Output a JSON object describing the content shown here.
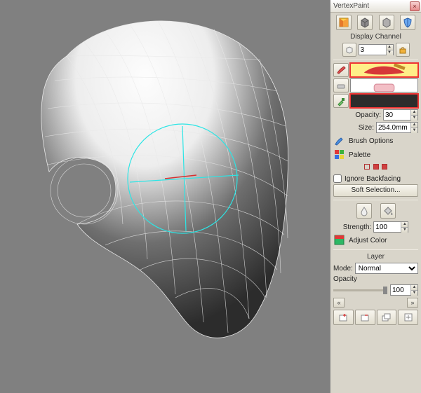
{
  "panel": {
    "title": "VertexPaint",
    "close": "×",
    "display_channel_label": "Display Channel",
    "channel_value": "3",
    "opacity_label": "Opacity:",
    "opacity_value": "30",
    "size_label": "Size:",
    "size_value": "254.0mm",
    "brush_options": "Brush Options",
    "palette": "Palette",
    "ignore_backfacing": "Ignore Backfacing",
    "soft_selection": "Soft Selection...",
    "strength_label": "Strength:",
    "strength_value": "100",
    "adjust_color": "Adjust Color",
    "layer_label": "Layer",
    "mode_label": "Mode:",
    "mode_value": "Normal",
    "layer_opacity_label": "Opacity",
    "layer_opacity_value": "100",
    "nav_prev": "«",
    "nav_next": "»"
  },
  "icons": {
    "shaded_box": "shaded-box",
    "cubes": "cubes",
    "shield": "shield",
    "object": "mesh-object",
    "lock": "lock",
    "paint": "paint-tool",
    "erase": "erase-tool",
    "picker": "eyedropper",
    "brush": "brush",
    "palette": "palette-swatch",
    "drop": "droplet",
    "bucket": "bucket",
    "adjust": "adjust-swatch",
    "layer_new": "new-layer",
    "layer_del": "delete-layer",
    "layer_dup": "duplicate-layer",
    "layer_merge": "merge-layer"
  }
}
